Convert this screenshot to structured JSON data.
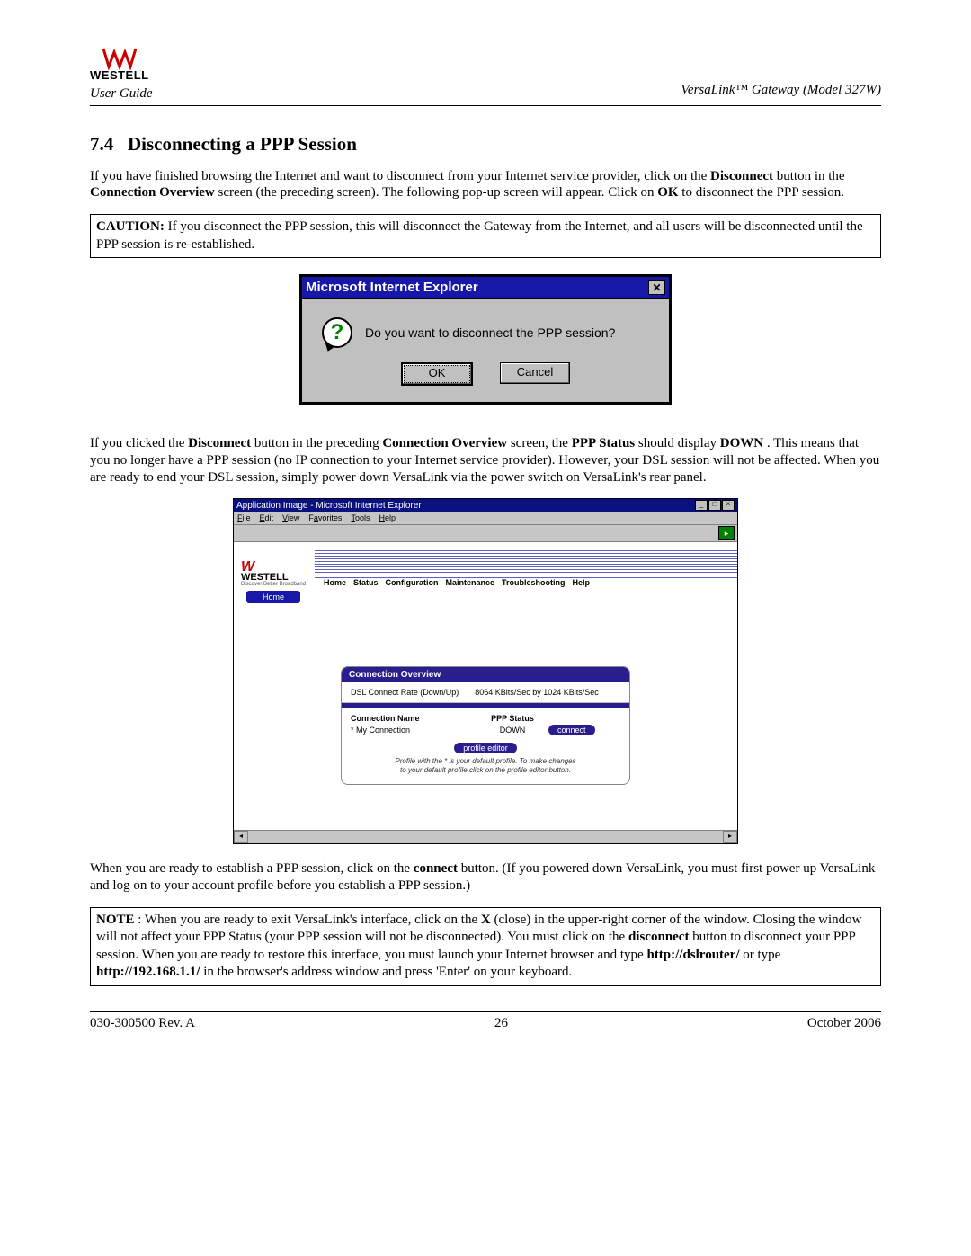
{
  "header": {
    "brand": "WESTELL",
    "left": "User Guide",
    "right": "VersaLink™ Gateway (Model 327W)"
  },
  "section": {
    "number": "7.4",
    "title": "Disconnecting a PPP Session"
  },
  "para1": {
    "t1": "If you have finished browsing the Internet and want to disconnect from your Internet service provider, click on the ",
    "b1": "Disconnect",
    "t2": " button in the ",
    "b2": "Connection Overview",
    "t3": " screen (the preceding screen). The following pop-up screen will appear. Click on ",
    "b3": "OK",
    "t4": " to disconnect the PPP session."
  },
  "caution": {
    "b1": "CAUTION:",
    "t1": " If you disconnect the PPP session, this will disconnect the Gateway from the Internet, and all users will be disconnected until the PPP session is re-established."
  },
  "dialog": {
    "title": "Microsoft Internet Explorer",
    "message": "Do you want to disconnect the PPP session?",
    "ok": "OK",
    "cancel": "Cancel"
  },
  "para2": {
    "t1": "If you clicked the ",
    "b1": "Disconnect",
    "t2": " button in the preceding ",
    "b2": "Connection Overview",
    "t3": " screen, the ",
    "b3": "PPP Status",
    "t4": " should display ",
    "b4": "DOWN",
    "t5": ". This means that you no longer have a PPP session (no IP connection to your Internet service provider). However, your DSL session will not be affected. When you are ready to end your DSL session, simply power down VersaLink via the power switch on VersaLink's rear panel."
  },
  "browser": {
    "title": "Application Image - Microsoft Internet Explorer",
    "menu": {
      "file": "File",
      "edit": "Edit",
      "view": "View",
      "favorites": "Favorites",
      "tools": "Tools",
      "help": "Help"
    },
    "brand": "WESTELL",
    "brand_sub": "Discover Better Broadband",
    "nav": {
      "home": "Home",
      "status": "Status",
      "config": "Configuration",
      "maint": "Maintenance",
      "trouble": "Troubleshooting",
      "help": "Help"
    },
    "home_tab": "Home",
    "panel": {
      "title": "Connection Overview",
      "rate_label": "DSL Connect Rate (Down/Up)",
      "rate_value": "8064 KBits/Sec by 1024 KBits/Sec",
      "col1": "Connection Name",
      "col2": "PPP Status",
      "conn_name": "* My Connection",
      "ppp_status": "DOWN",
      "connect": "connect",
      "profile_editor": "profile editor",
      "note1": "Profile with the * is your default profile. To make changes",
      "note2": "to your default profile click on the profile editor button."
    }
  },
  "para3": {
    "t1": "When you are ready to establish a PPP session, click on the ",
    "b1": "connect",
    "t2": " button. (If you powered down VersaLink, you must first power up VersaLink and log on to your account profile before you establish a PPP session.)"
  },
  "note": {
    "b1": "NOTE",
    "t1": ":  When you are ready to exit VersaLink's interface, click on the ",
    "b2": "X",
    "t2": " (close) in the upper-right corner of the window. Closing the window will not affect your PPP Status (your PPP session will not be disconnected). You must click on the ",
    "b3": "disconnect",
    "t3": " button to disconnect your PPP session. When you are ready to restore this interface, you must launch your Internet browser and type ",
    "b4": "http://dslrouter/",
    "t4": " or type ",
    "b5": "http://192.168.1.1/",
    "t5": " in the browser's address window and press 'Enter' on your keyboard."
  },
  "footer": {
    "left": "030-300500 Rev. A",
    "center": "26",
    "right": "October 2006"
  }
}
